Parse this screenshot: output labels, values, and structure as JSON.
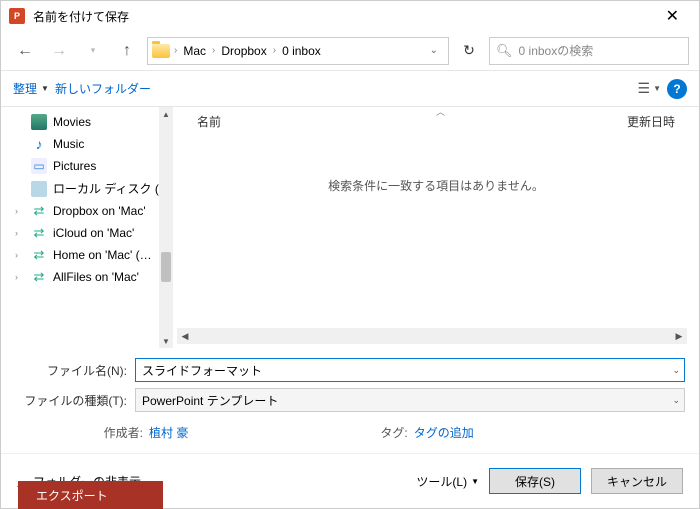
{
  "dialog": {
    "title": "名前を付けて保存"
  },
  "breadcrumb": {
    "items": [
      "Mac",
      "Dropbox",
      "0 inbox"
    ]
  },
  "search": {
    "placeholder": "0 inboxの検索"
  },
  "toolbar": {
    "organize": "整理",
    "new_folder": "新しいフォルダー"
  },
  "tree": {
    "items": [
      {
        "label": "Movies",
        "icon": "movies"
      },
      {
        "label": "Music",
        "icon": "music"
      },
      {
        "label": "Pictures",
        "icon": "pictures"
      },
      {
        "label": "ローカル ディスク (C:)",
        "icon": "disk"
      },
      {
        "label": "Dropbox on 'Mac'",
        "icon": "net",
        "chevron": true
      },
      {
        "label": "iCloud on 'Mac'",
        "icon": "net",
        "chevron": true
      },
      {
        "label": "Home on 'Mac' (…",
        "icon": "net",
        "chevron": true
      },
      {
        "label": "AllFiles on 'Mac'",
        "icon": "net",
        "chevron": true
      }
    ]
  },
  "columns": {
    "name": "名前",
    "modified": "更新日時"
  },
  "content": {
    "empty": "検索条件に一致する項目はありません。"
  },
  "form": {
    "filename_label": "ファイル名(N):",
    "filename_value": "スライドフォーマット",
    "type_label": "ファイルの種類(T):",
    "type_value": "PowerPoint テンプレート",
    "author_label": "作成者:",
    "author_value": "植村 豪",
    "tags_label": "タグ:",
    "tags_placeholder": "タグの追加"
  },
  "footer": {
    "hide_folders": "フォルダーの非表示",
    "tools": "ツール(L)",
    "save": "保存(S)",
    "cancel": "キャンセル"
  },
  "background": {
    "export": "エクスポート"
  }
}
